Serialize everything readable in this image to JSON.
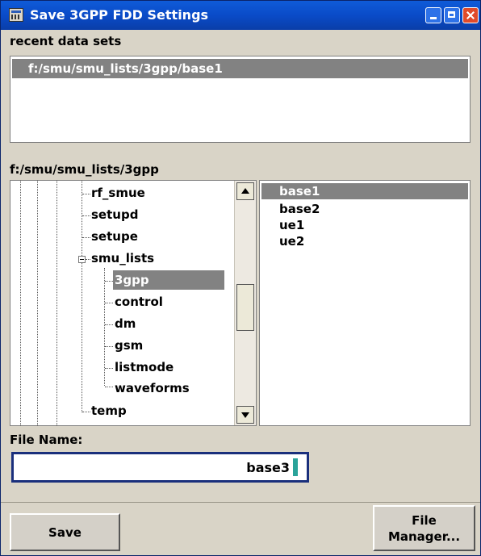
{
  "window": {
    "title": "Save 3GPP FDD Settings"
  },
  "recent": {
    "label": "recent data sets",
    "items": [
      "f:/smu/smu_lists/3gpp/base1"
    ]
  },
  "browser": {
    "path": "f:/smu/smu_lists/3gpp",
    "tree": [
      {
        "label": "rf_smue"
      },
      {
        "label": "setupd"
      },
      {
        "label": "setupe"
      },
      {
        "label": "smu_lists",
        "expanded": true
      },
      {
        "label": "3gpp",
        "selected": true
      },
      {
        "label": "control"
      },
      {
        "label": "dm"
      },
      {
        "label": "gsm"
      },
      {
        "label": "listmode"
      },
      {
        "label": "waveforms"
      },
      {
        "label": "temp"
      }
    ],
    "files": [
      "base1",
      "base2",
      "ue1",
      "ue2"
    ],
    "selected_file": "base1"
  },
  "filename": {
    "label": "File Name:",
    "value": "base3"
  },
  "buttons": {
    "save": "Save",
    "file_manager_line1": "File",
    "file_manager_line2": "Manager..."
  },
  "colors": {
    "titlebar": "#0a4bc8",
    "selection": "#828282",
    "dialog_bg": "#d9d4c7",
    "input_border": "#1a2f7c",
    "caret": "#2aa39a"
  }
}
